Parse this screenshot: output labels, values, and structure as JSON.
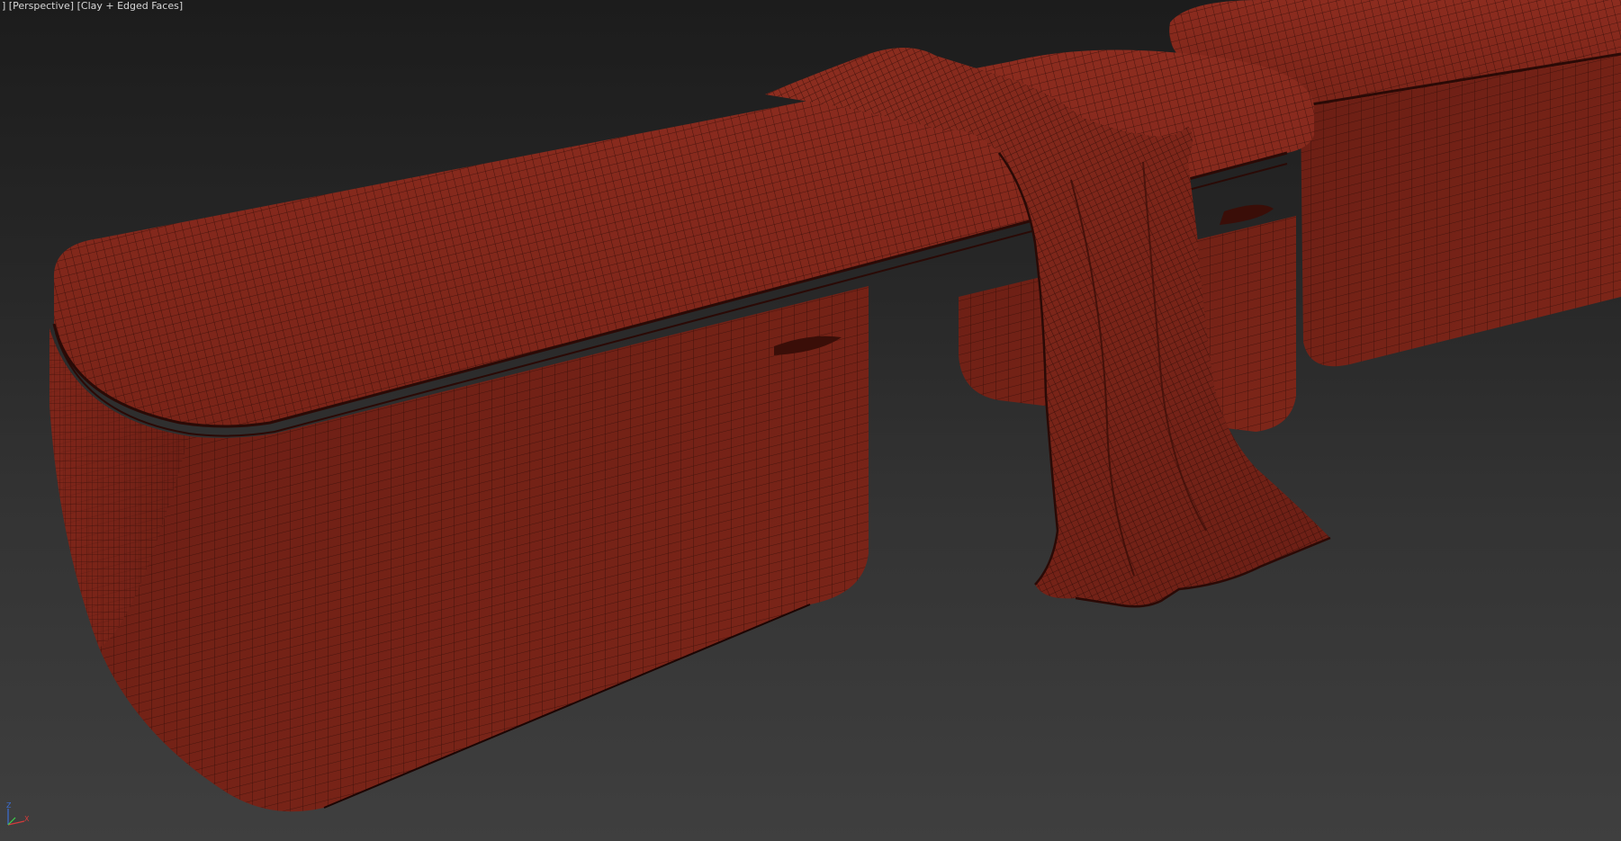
{
  "viewport": {
    "bracket_prefix": "]",
    "view_label": "[Perspective]",
    "shading_label": "[Clay + Edged Faces]",
    "background_top": "#1c1c1c",
    "background_bottom": "#3f3f3f"
  },
  "scene": {
    "object_color": "#7a2418",
    "wire_color": "#2a0a06",
    "objects": [
      "bench-seat-cushion",
      "bench-base-left",
      "bench-base-right",
      "draped-blanket",
      "second-bench"
    ]
  },
  "axis_gizmo": {
    "z_label": "Z",
    "x_label": "X",
    "z_color": "#3b6fd4",
    "x_color": "#d43b3b",
    "y_color": "#3bd44a"
  }
}
